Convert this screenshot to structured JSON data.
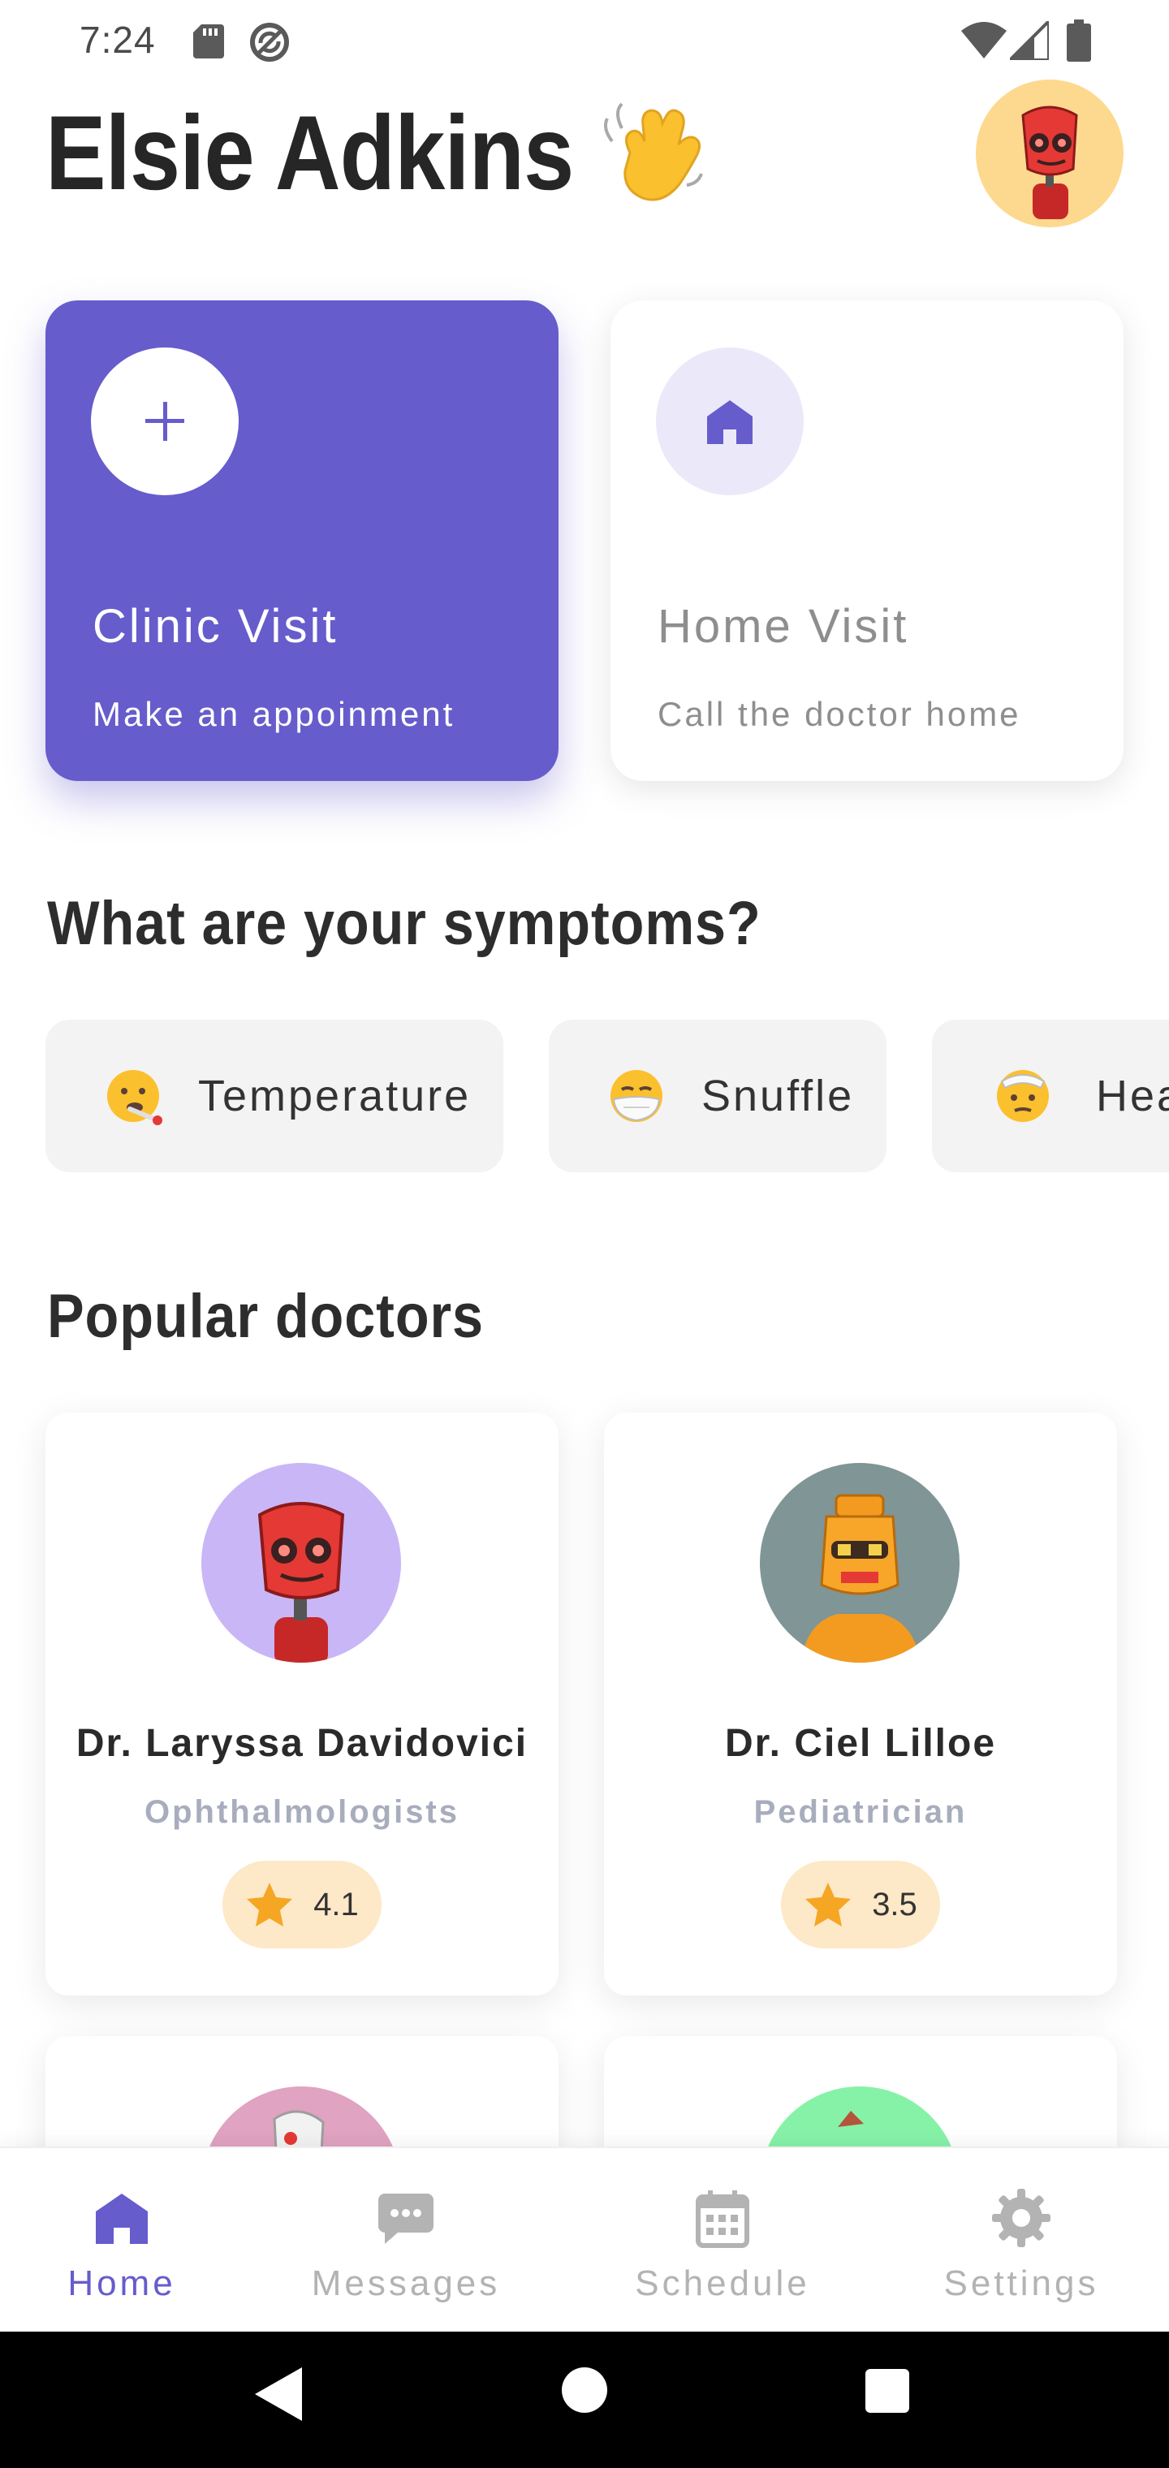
{
  "status_bar": {
    "time": "7:24",
    "icons": [
      "sd-card-icon",
      "sync-icon",
      "wifi-icon",
      "signal-icon",
      "battery-icon"
    ]
  },
  "header": {
    "user_name": "Elsie Adkins",
    "greeting_emoji": "waving-hand-icon",
    "avatar": "robot-avatar"
  },
  "visit_cards": [
    {
      "title": "Clinic Visit",
      "subtitle": "Make an appoinment",
      "icon": "plus-icon",
      "active": true
    },
    {
      "title": "Home Visit",
      "subtitle": "Call the doctor home",
      "icon": "home-icon",
      "active": false
    }
  ],
  "symptoms": {
    "title": "What are your symptoms?",
    "items": [
      {
        "label": "Temperature",
        "emoji": "face-with-thermometer-icon"
      },
      {
        "label": "Snuffle",
        "emoji": "face-with-mask-icon"
      },
      {
        "label": "Headache",
        "emoji": "face-with-bandage-icon"
      }
    ]
  },
  "doctors": {
    "title": "Popular doctors",
    "items": [
      {
        "name": "Dr. Laryssa Davidovici",
        "specialty": "Ophthalmologists",
        "rating": "4.1"
      },
      {
        "name": "Dr. Ciel Lilloe",
        "specialty": "Pediatrician",
        "rating": "3.5"
      },
      {
        "name": "",
        "specialty": "",
        "rating": ""
      },
      {
        "name": "",
        "specialty": "",
        "rating": ""
      }
    ]
  },
  "bottom_nav": {
    "items": [
      {
        "label": "Home",
        "icon": "home-icon",
        "active": true
      },
      {
        "label": "Messages",
        "icon": "chat-icon",
        "active": false
      },
      {
        "label": "Schedule",
        "icon": "calendar-icon",
        "active": false
      },
      {
        "label": "Settings",
        "icon": "gear-icon",
        "active": false
      }
    ]
  },
  "colors": {
    "primary": "#665ccc",
    "primary_light": "#ebe9f9",
    "rating_bg": "#fde8c8",
    "star": "#f5a623",
    "chip_bg": "#f3f3f3"
  }
}
